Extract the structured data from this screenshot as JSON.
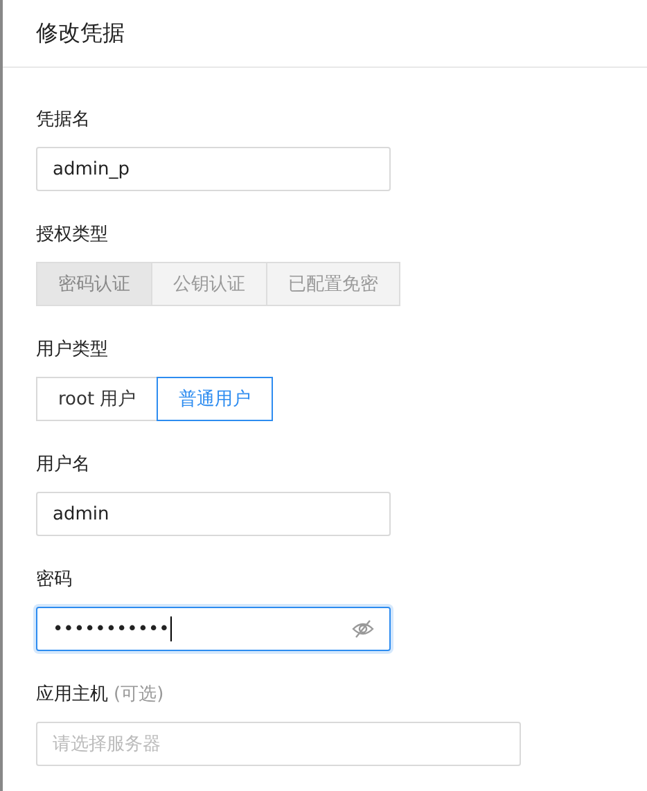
{
  "title": "修改凭据",
  "fields": [
    {
      "kind": "input",
      "label": "凭据名",
      "value": "admin_p",
      "focused": false
    },
    {
      "kind": "segment",
      "label": "授权类型",
      "disabled": true,
      "options": [
        {
          "label": "密码认证",
          "selected": true
        },
        {
          "label": "公钥认证",
          "selected": false
        },
        {
          "label": "已配置免密",
          "selected": false
        }
      ]
    },
    {
      "kind": "segment",
      "label": "用户类型",
      "disabled": false,
      "options": [
        {
          "label": "root 用户",
          "selected": false
        },
        {
          "label": "普通用户",
          "selected": true
        }
      ]
    },
    {
      "kind": "input",
      "label": "用户名",
      "value": "admin",
      "focused": false
    },
    {
      "kind": "password",
      "label": "密码",
      "value": "•••••••••••",
      "focused": true
    },
    {
      "kind": "select",
      "label": "应用主机",
      "hint": "(可选)",
      "placeholder": "请选择服务器"
    }
  ]
}
